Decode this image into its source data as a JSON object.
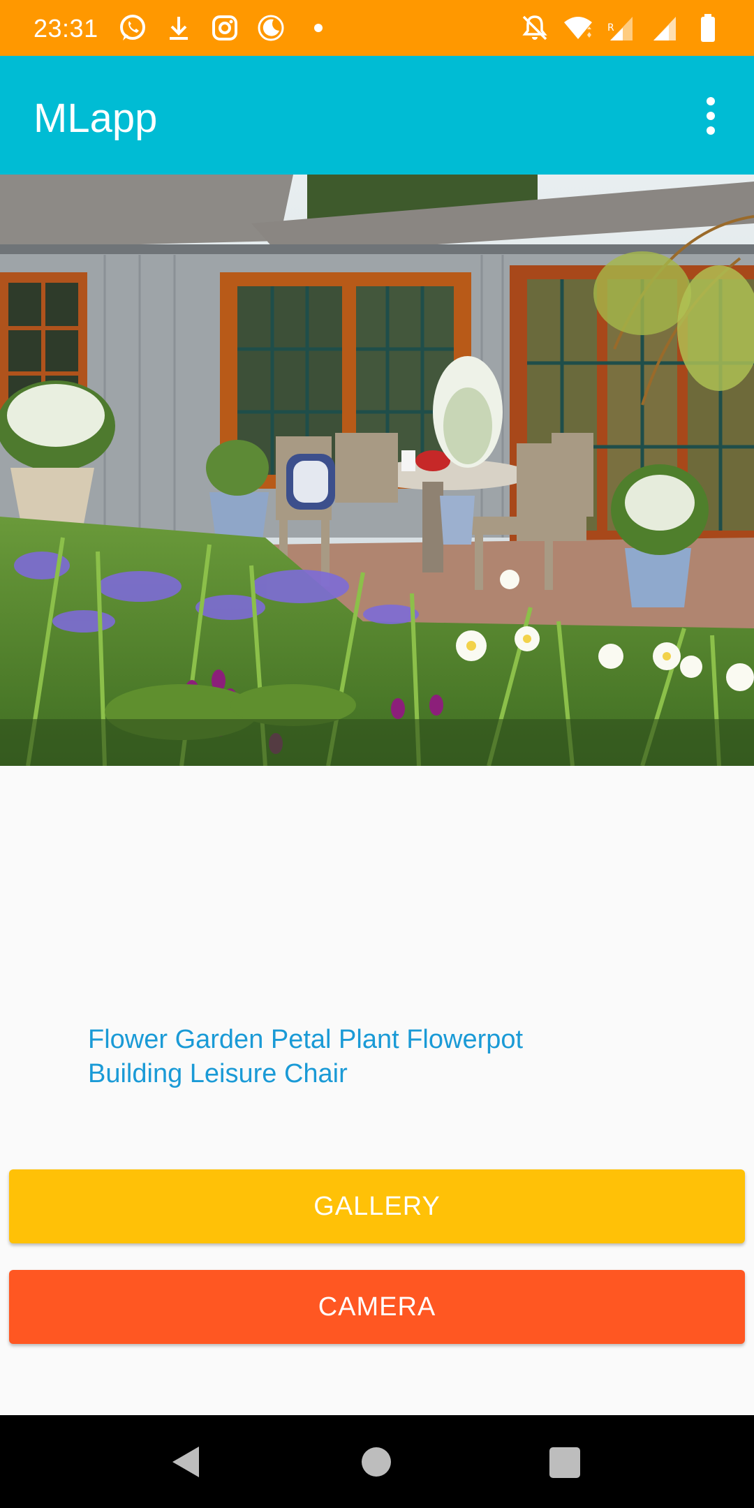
{
  "status_bar": {
    "time": "23:31",
    "left_icons": [
      "whatsapp-icon",
      "download-icon",
      "instagram-icon",
      "night-mode-icon",
      "notification-dot"
    ],
    "right_icons": [
      "mute-icon",
      "wifi-icon",
      "signal-roaming-icon",
      "signal-icon",
      "battery-icon"
    ],
    "roaming_indicator": "R"
  },
  "app_bar": {
    "title": "MLapp",
    "menu_icon": "more-vert-icon"
  },
  "photo": {
    "description_icon": "garden-patio-image"
  },
  "result": {
    "labels": "Flower Garden Petal Plant Flowerpot Building Leisure Chair"
  },
  "buttons": {
    "gallery": "GALLERY",
    "camera": "CAMERA"
  },
  "nav_bar": {
    "icons": [
      "back-icon",
      "home-icon",
      "recents-icon"
    ]
  },
  "colors": {
    "status_bar": "#ff9800",
    "app_bar": "#00bcd4",
    "gallery_button": "#ffc107",
    "camera_button": "#ff5722",
    "labels_text": "#1a9ad6"
  }
}
